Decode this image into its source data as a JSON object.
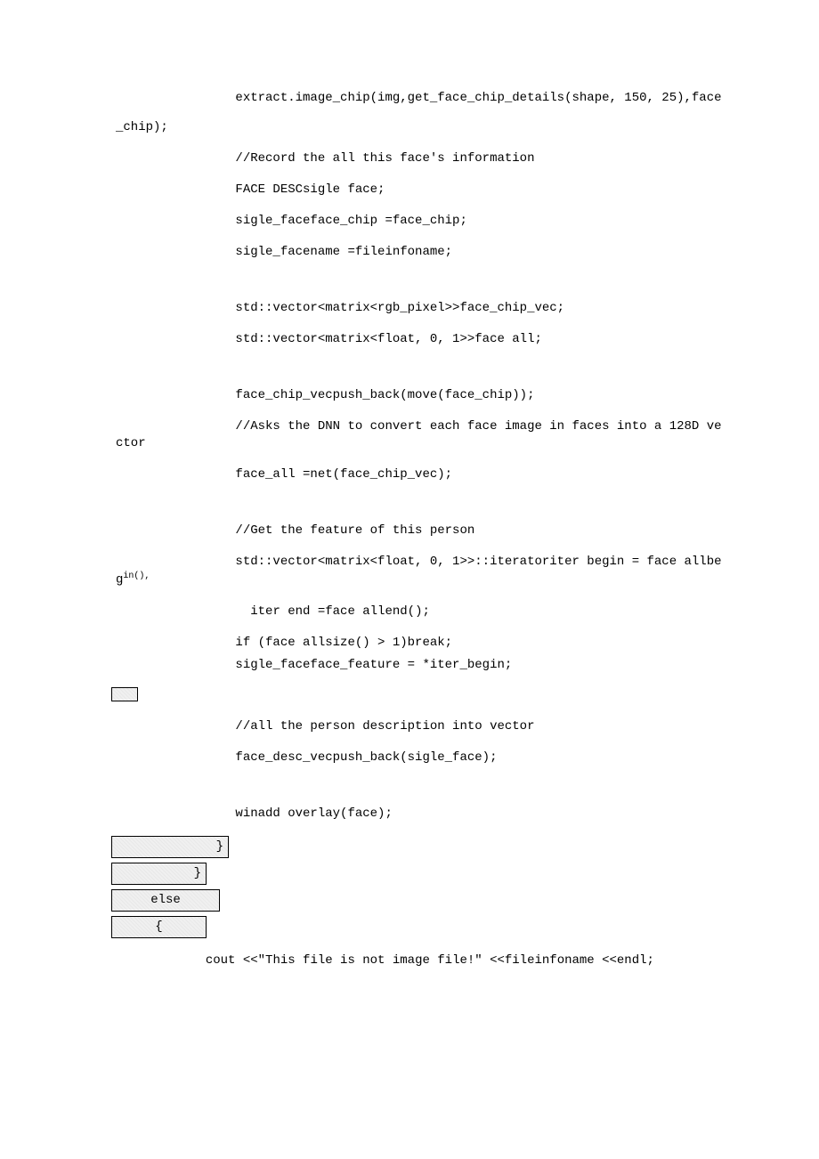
{
  "lines": {
    "l1_part1": "                extract.image_chip(img,get_face_chip_details(shape, 150, 25),face",
    "l1_part2": "_chip);",
    "l2": "                //Record the all this face's information",
    "l3": "                FACE DESCsigle face;",
    "l4": "                sigle_faceface_chip =face_chip;",
    "l5": "                sigle_facename =fileinfoname;",
    "l6": "                std::vector<matrix<rgb_pixel>>face_chip_vec;",
    "l7": "                std::vector<matrix<float, 0, 1>>face all;",
    "l8": "                face_chip_vecpush_back(move(face_chip));",
    "l9_part1": "                //Asks the DNN to convert each face image in faces into a 128D ve",
    "l9_part2": "ctor",
    "l10": "                face_all =net(face_chip_vec);",
    "l11": "                //Get the feature of this person",
    "l12_part1": "                std::vector<matrix<float, 0, 1>>::iteratoriter begin = face allbe",
    "l12_part2a": "g",
    "l12_part2b": "in(),",
    "l13": "                  iter end =face allend();",
    "l14": "                if (face allsize() > 1)break;",
    "l15": "                sigle_faceface_feature = *iter_begin;",
    "l16": "                //all the person description into vector",
    "l17": "                face_desc_vecpush_back(sigle_face);",
    "l18": "                winadd overlay(face);",
    "box1": "            }",
    "box2": "     }",
    "box3": "    else",
    "box4": "     {",
    "l19": "            cout <<\"This file is not image file!\" <<fileinfoname <<endl;"
  }
}
